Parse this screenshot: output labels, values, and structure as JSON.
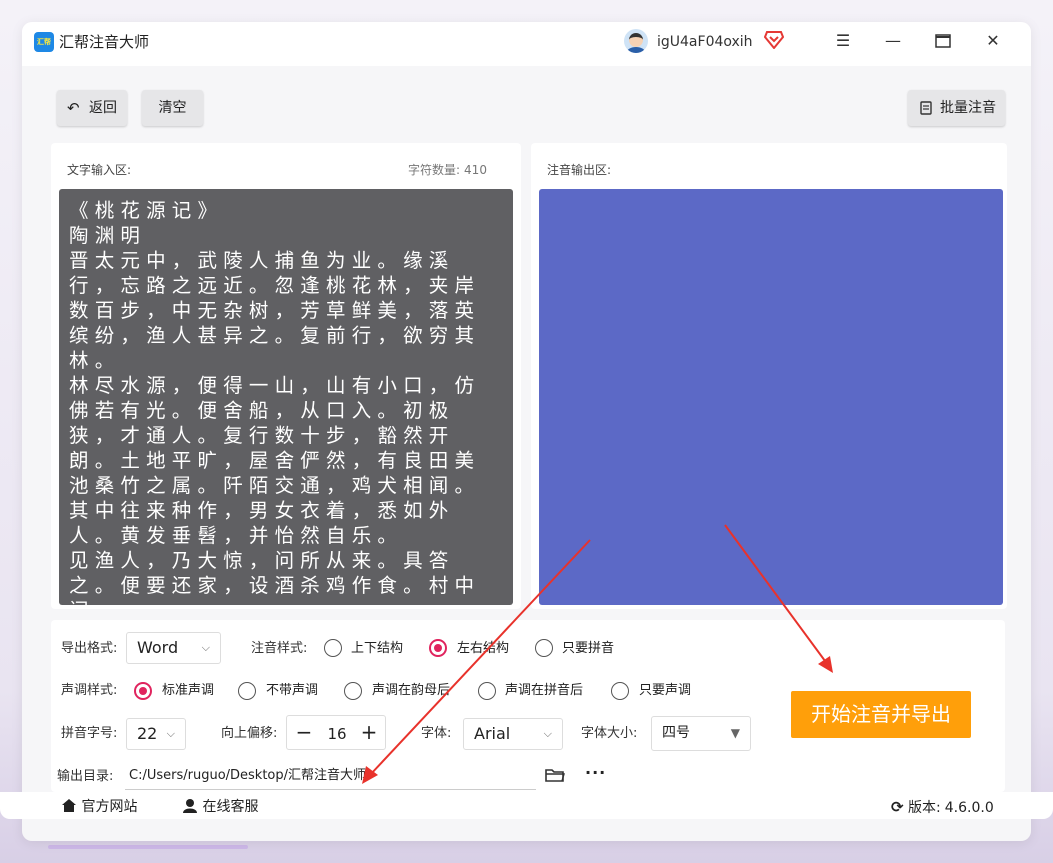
{
  "app": {
    "title": "汇帮注音大师",
    "logo_text": "汇帮"
  },
  "user": {
    "name": "igU4aF04oxih"
  },
  "toolbar": {
    "back_label": "返回",
    "clear_label": "清空",
    "batch_label": "批量注音"
  },
  "input_panel": {
    "label": "文字输入区:",
    "char_count_label": "字符数量:",
    "char_count": "410",
    "text": "《桃花源记》\n陶渊明\n晋太元中，武陵人捕鱼为业。缘溪行，忘路之远近。忽逢桃花林，夹岸数百步，中无杂树，芳草鲜美，落英缤纷，渔人甚异之。复前行，欲穷其林。\n林尽水源，便得一山，山有小口，仿佛若有光。便舍船，从口入。初极狭，才通人。复行数十步，豁然开朗。土地平旷，屋舍俨然，有良田美池桑竹之属。阡陌交通，鸡犬相闻。其中往来种作，男女衣着，悉如外人。黄发垂髫，并怡然自乐。\n见渔人，乃大惊，问所从来。具答之。便要还家，设酒杀鸡作食。村中闻"
  },
  "output_panel": {
    "label": "注音输出区:"
  },
  "options": {
    "export_format_label": "导出格式:",
    "export_format_value": "Word",
    "annotation_style_label": "注音样式:",
    "annotation_styles": [
      "上下结构",
      "左右结构",
      "只要拼音"
    ],
    "tone_style_label": "声调样式:",
    "tone_styles": [
      "标准声调",
      "不带声调",
      "声调在韵母后",
      "声调在拼音后",
      "只要声调"
    ],
    "pinyin_size_label": "拼音字号:",
    "pinyin_size_value": "22",
    "offset_label": "向上偏移:",
    "offset_value": "16",
    "font_label": "字体:",
    "font_value": "Arial",
    "font_size_label": "字体大小:",
    "font_size_value": "四号",
    "output_dir_label": "输出目录:",
    "output_dir_value": "C:/Users/ruguo/Desktop/汇帮注音大师"
  },
  "start_button_label": "开始注音并导出",
  "footer": {
    "website_label": "官方网站",
    "support_label": "在线客服",
    "version_label": "版本:",
    "version_value": "4.6.0.0"
  },
  "colors": {
    "accent": "#e0245e",
    "start_button": "#ff9f0a",
    "output_bg": "#5c69c6",
    "input_bg": "#606063",
    "arrow": "#e8322b"
  }
}
